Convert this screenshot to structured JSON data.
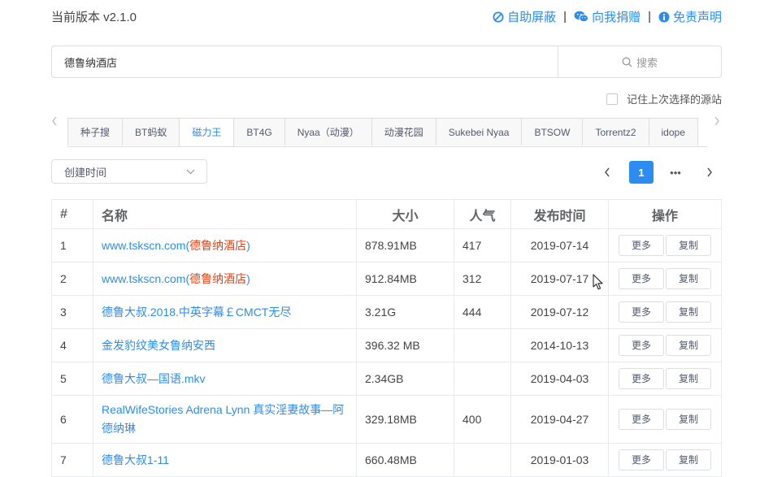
{
  "header": {
    "version": "当前版本 v2.1.0",
    "links": [
      {
        "label": "自助屏蔽",
        "icon": "ban-icon"
      },
      {
        "label": "向我捐赠",
        "icon": "wechat-icon"
      },
      {
        "label": "免责声明",
        "icon": "info-icon"
      }
    ],
    "separator": "|"
  },
  "search": {
    "value": "德鲁纳酒店",
    "button_label": "搜索",
    "button_icon": "search-icon"
  },
  "remember": {
    "label": "记住上次选择的源站",
    "checked": false
  },
  "tabs": {
    "prev_icon": "chevron-left-icon",
    "next_icon": "chevron-right-icon",
    "items": [
      "种子搜",
      "BT蚂蚁",
      "磁力王",
      "BT4G",
      "Nyaa（动漫）",
      "动漫花园",
      "Sukebei Nyaa",
      "BTSOW",
      "Torrentz2",
      "idope"
    ],
    "active_index": 2
  },
  "sort": {
    "selected": "创建时间",
    "icon": "chevron-down-icon"
  },
  "pager": {
    "current": "1",
    "ellipsis": "•••",
    "prev_icon": "chevron-left-icon",
    "next_icon": "chevron-right-icon"
  },
  "table": {
    "columns": [
      "#",
      "名称",
      "大小",
      "人气",
      "发布时间",
      "操作"
    ],
    "actions": {
      "more": "更多",
      "copy": "复制"
    },
    "rows": [
      {
        "index": "1",
        "title_pre": "www.tskscn.com(",
        "title_hl": "德鲁纳酒店",
        "title_post": ")",
        "size": "878.91MB",
        "hot": "417",
        "date": "2019-07-14"
      },
      {
        "index": "2",
        "title_pre": "www.tskscn.com(",
        "title_hl": "德鲁纳酒店",
        "title_post": ")",
        "size": "912.84MB",
        "hot": "312",
        "date": "2019-07-17"
      },
      {
        "index": "3",
        "title_pre": "德鲁大叔.2018.中英字幕￡CMCT无尽",
        "title_hl": "",
        "title_post": "",
        "size": "3.21G",
        "hot": "444",
        "date": "2019-07-12"
      },
      {
        "index": "4",
        "title_pre": "金发豹纹美女鲁纳安西",
        "title_hl": "",
        "title_post": "",
        "size": "396.32 MB",
        "hot": "",
        "date": "2014-10-13"
      },
      {
        "index": "5",
        "title_pre": "德鲁大叔—国语.mkv",
        "title_hl": "",
        "title_post": "",
        "size": "2.34GB",
        "hot": "",
        "date": "2019-04-03"
      },
      {
        "index": "6",
        "title_pre": "RealWifeStories Adrena Lynn 真实淫妻故事—阿德纳琳",
        "title_hl": "",
        "title_post": "",
        "size": "329.18MB",
        "hot": "400",
        "date": "2019-04-27"
      },
      {
        "index": "7",
        "title_pre": "德鲁大叔1-11",
        "title_hl": "",
        "title_post": "",
        "size": "660.48MB",
        "hot": "",
        "date": "2019-01-03"
      }
    ]
  },
  "colors": {
    "accent": "#2d8cf0",
    "highlight": "#ed4014",
    "border": "#dcdee2"
  }
}
